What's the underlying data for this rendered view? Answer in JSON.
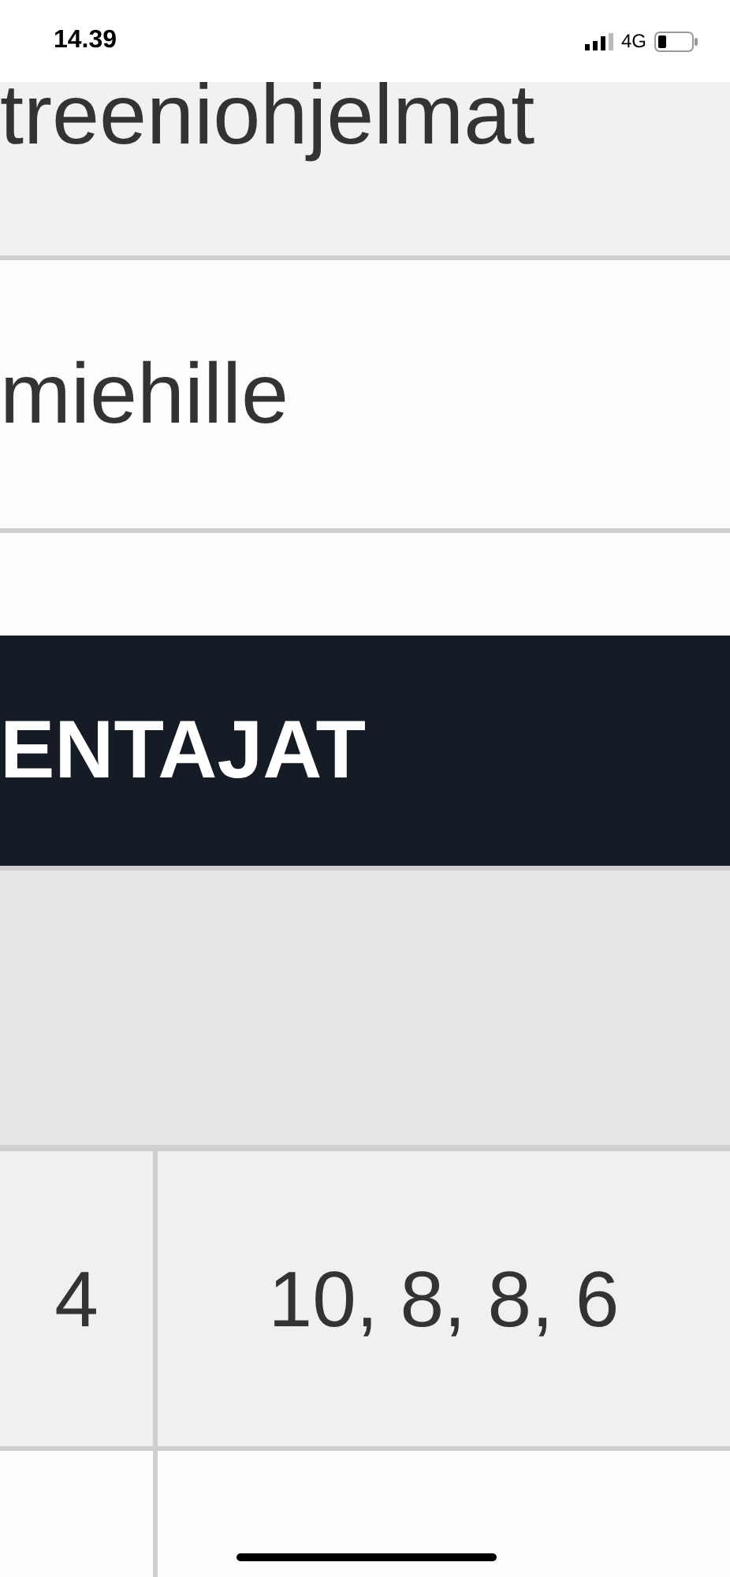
{
  "status_bar": {
    "time": "14.39",
    "network": "4G"
  },
  "list_items": [
    {
      "label": "treeniohjelmat"
    },
    {
      "label": "miehille"
    }
  ],
  "banner": {
    "title": "ENTAJAT"
  },
  "table": {
    "rows": [
      {
        "cells": [
          "4",
          "10, 8, 8, 6"
        ]
      }
    ]
  }
}
